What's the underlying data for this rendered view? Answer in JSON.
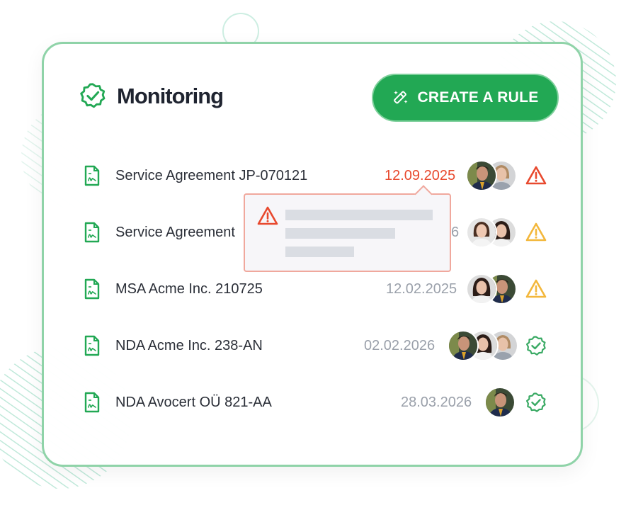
{
  "header": {
    "title": "Monitoring",
    "create_button_label": "CREATE A RULE"
  },
  "colors": {
    "accent_green": "#22a854",
    "card_border": "#8fd3a8",
    "overdue_red": "#e8492e",
    "warning_amber": "#f3b73b",
    "ok_green": "#3aaa64"
  },
  "documents": [
    {
      "name": "Service Agreement JP-070121",
      "date": "12.09.2025",
      "date_state": "overdue",
      "avatars": [
        "man-suit-avatar",
        "woman-light-hair-avatar"
      ],
      "status_icon": "warning-red-icon"
    },
    {
      "name": "Service Agreement",
      "date": "6",
      "date_state": "normal",
      "avatars": [
        "woman-smiling-avatar",
        "woman-dark-hair-avatar"
      ],
      "status_icon": "warning-amber-icon"
    },
    {
      "name": "MSA Acme Inc. 210725",
      "date": "12.02.2025",
      "date_state": "normal",
      "avatars": [
        "woman-dark-hair-avatar",
        "man-suit-avatar"
      ],
      "status_icon": "warning-amber-icon"
    },
    {
      "name": "NDA Acme Inc. 238-AN",
      "date": "02.02.2026",
      "date_state": "normal",
      "avatars": [
        "man-suit-avatar",
        "woman-dark-hair-avatar",
        "woman-light-hair-avatar"
      ],
      "status_icon": "check-badge-icon"
    },
    {
      "name": "NDA Avocert OÜ 821-AA",
      "date": "28.03.2026",
      "date_state": "normal",
      "avatars": [
        "man-suit-avatar"
      ],
      "status_icon": "check-badge-icon"
    }
  ],
  "tooltip": {
    "icon": "warning-red-icon"
  }
}
